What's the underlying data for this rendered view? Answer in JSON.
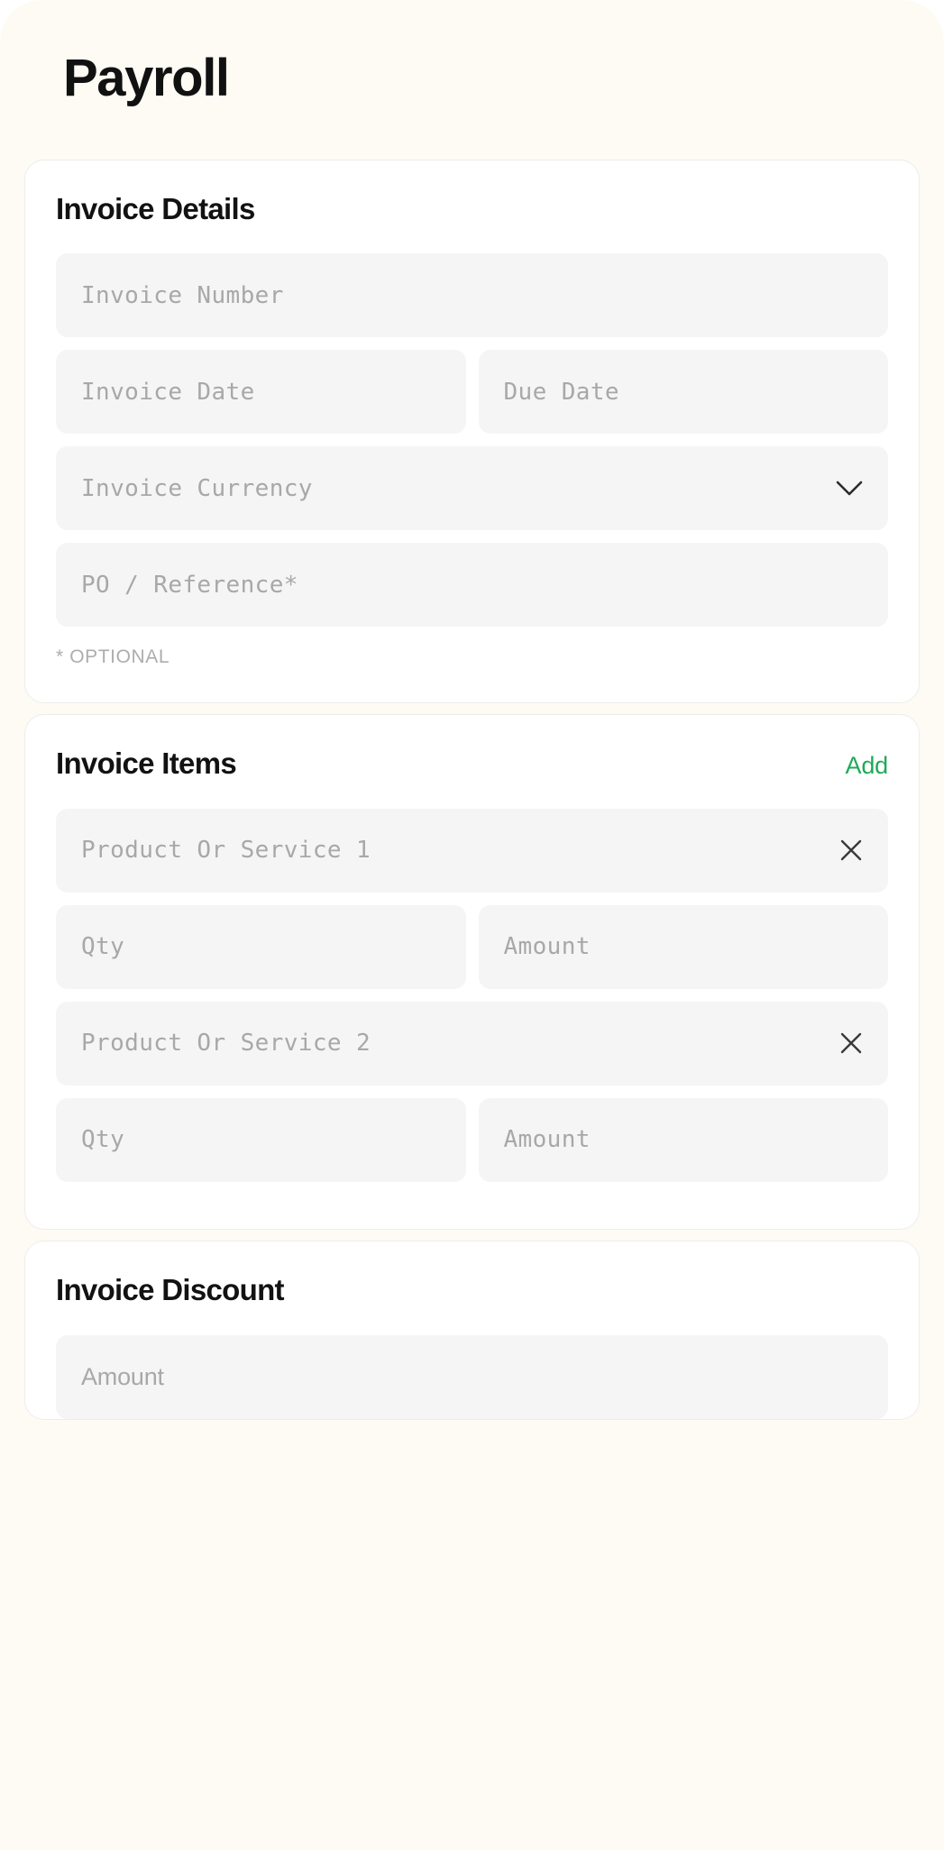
{
  "page": {
    "title": "Payroll",
    "background_color": "#fdfbf4",
    "accent_color": "#1faa59"
  },
  "invoice_details": {
    "title": "Invoice Details",
    "fields": {
      "invoice_number": "Invoice Number",
      "invoice_date": "Invoice Date",
      "due_date": "Due Date",
      "invoice_currency": "Invoice Currency",
      "po_reference": "PO / Reference*"
    },
    "currency_chevron_icon": "chevron-down-icon",
    "optional_note": "* OPTIONAL"
  },
  "invoice_items": {
    "title": "Invoice Items",
    "add_label": "Add",
    "remove_icon": "close-icon",
    "items": [
      {
        "name_placeholder": "Product Or Service 1",
        "qty_placeholder": "Qty",
        "amount_placeholder": "Amount"
      },
      {
        "name_placeholder": "Product Or Service 2",
        "qty_placeholder": "Qty",
        "amount_placeholder": "Amount"
      }
    ]
  },
  "invoice_discount": {
    "title": "Invoice Discount",
    "amount_placeholder": "Amount"
  }
}
